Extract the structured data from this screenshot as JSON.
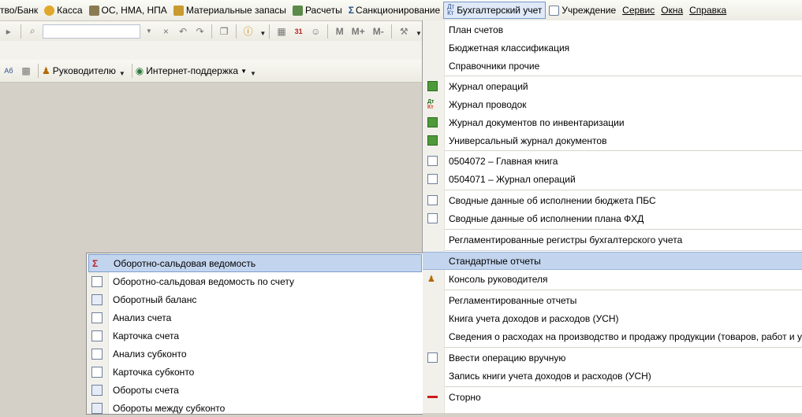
{
  "menubar": {
    "items": [
      {
        "label": "тво/Банк",
        "icon": "bank-icon"
      },
      {
        "label": "Касса",
        "icon": "coins-icon"
      },
      {
        "label": "ОС, НМА, НПА",
        "icon": "truck-icon"
      },
      {
        "label": "Материальные запасы",
        "icon": "warehouse-icon"
      },
      {
        "label": "Расчеты",
        "icon": "payments-icon"
      },
      {
        "label": "Санкционирование",
        "icon": "sigma-icon"
      },
      {
        "label": "Бухгалтерский учет",
        "icon": "accounting-icon"
      },
      {
        "label": "Учреждение",
        "icon": "document-icon"
      },
      {
        "label": "Сервис"
      },
      {
        "label": "Окна"
      },
      {
        "label": "Справка"
      }
    ],
    "active_item": "Бухгалтерский учет"
  },
  "toolbar": {
    "search_value": "",
    "memory_buttons": [
      "M",
      "M+",
      "M-"
    ],
    "calendar_day": "31",
    "manager_label": "Руководителю",
    "internet_support_label": "Интернет-поддержка"
  },
  "accounting_menu": {
    "items": [
      {
        "label": "План счетов",
        "icon": ""
      },
      {
        "label": "Бюджетная классификация",
        "icon": ""
      },
      {
        "label": "Справочники прочие",
        "icon": ""
      },
      {
        "label": "Журнал операций",
        "icon": "journal-icon"
      },
      {
        "label": "Журнал проводок",
        "icon": "dt-kt-icon"
      },
      {
        "label": "Журнал документов по инвентаризации",
        "icon": "journal-icon"
      },
      {
        "label": "Универсальный журнал документов",
        "icon": "journal-icon"
      },
      {
        "label": "0504072  –  Главная книга",
        "icon": "report-icon"
      },
      {
        "label": "0504071  –  Журнал операций",
        "icon": "report-icon"
      },
      {
        "label": "Сводные данные об исполнении бюджета ПБС",
        "icon": "report-icon"
      },
      {
        "label": "Сводные данные об исполнении плана ФХД",
        "icon": "report-icon"
      },
      {
        "label": "Регламентированные регистры бухгалтерского учета",
        "icon": ""
      },
      {
        "label": "Стандартные отчеты",
        "icon": ""
      },
      {
        "label": "Консоль руководителя",
        "icon": "console-icon"
      },
      {
        "label": "Регламентированные отчеты",
        "icon": ""
      },
      {
        "label": "Книга учета доходов и расходов (УСН)",
        "icon": ""
      },
      {
        "label": "Сведения о расходах на производство и продажу продукции (товаров, работ и услуг)",
        "icon": ""
      },
      {
        "label": "Ввести операцию вручную",
        "icon": "manual-entry-icon"
      },
      {
        "label": "Запись книги учета доходов и расходов (УСН)",
        "icon": ""
      },
      {
        "label": "Сторно",
        "icon": "storno-icon"
      }
    ],
    "highlighted": "Стандартные отчеты"
  },
  "standard_reports_submenu": {
    "items": [
      {
        "label": "Оборотно-сальдовая ведомость",
        "icon": "sigma-report-icon"
      },
      {
        "label": "Оборотно-сальдовая ведомость по счету",
        "icon": "account-report-icon"
      },
      {
        "label": "Оборотный баланс",
        "icon": "balance-icon"
      },
      {
        "label": "Анализ счета",
        "icon": "analysis-icon"
      },
      {
        "label": "Карточка счета",
        "icon": "card-icon"
      },
      {
        "label": "Анализ субконто",
        "icon": "analysis-icon"
      },
      {
        "label": "Карточка субконто",
        "icon": "card-icon"
      },
      {
        "label": "Обороты счета",
        "icon": "turnover-icon"
      },
      {
        "label": "Обороты между субконто",
        "icon": "turnover-icon"
      }
    ],
    "highlighted": "Оборотно-сальдовая ведомость"
  }
}
